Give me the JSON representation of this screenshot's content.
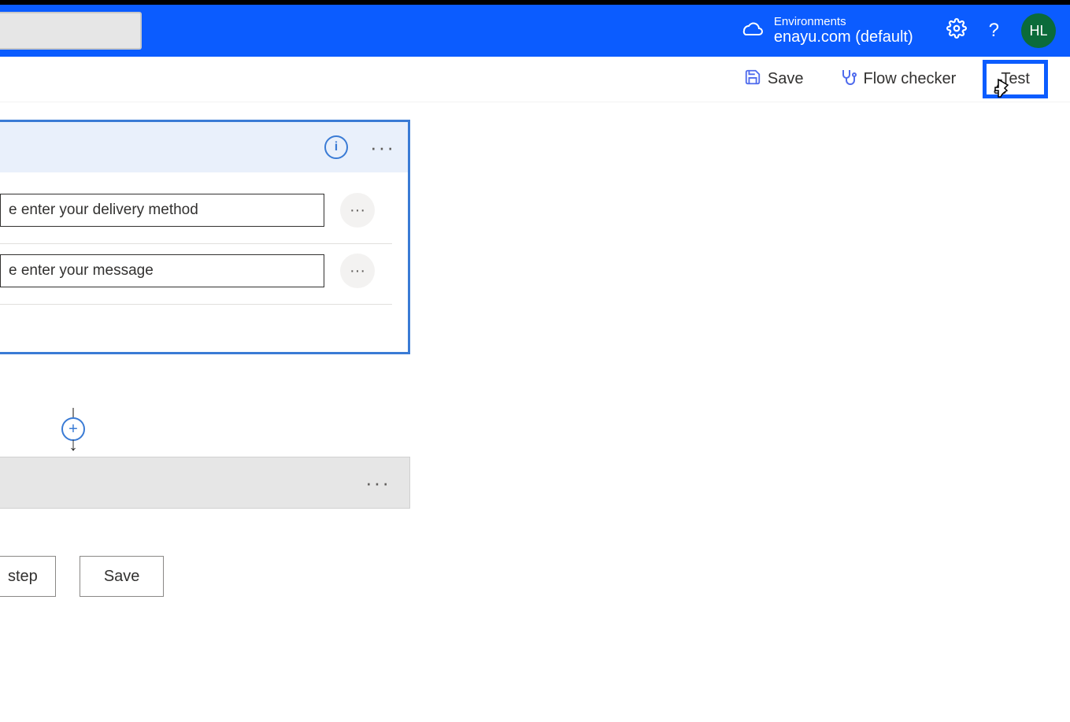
{
  "header": {
    "env_label": "Environments",
    "env_name": "enayu.com (default)",
    "avatar_initials": "HL"
  },
  "actionbar": {
    "save_label": "Save",
    "flow_checker_label": "Flow checker",
    "test_label": "Test"
  },
  "trigger_card": {
    "fields": [
      {
        "value": "e enter your delivery method"
      },
      {
        "value": "e enter your message"
      }
    ]
  },
  "bottom": {
    "new_step_label": "step",
    "save_label": "Save"
  },
  "icons": {
    "info": "i",
    "dots": "···",
    "plus": "+",
    "arrow": "↓",
    "help": "?",
    "gear": "⚙",
    "env": "☁"
  }
}
